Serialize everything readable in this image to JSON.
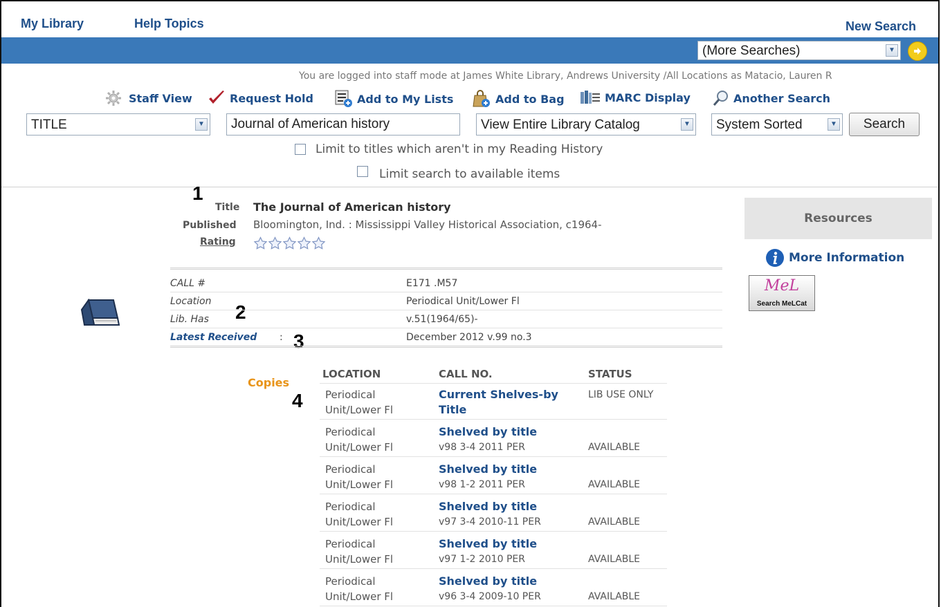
{
  "nav": {
    "my_library": "My Library",
    "help_topics": "Help Topics",
    "new_search": "New Search"
  },
  "bluebar": {
    "more_searches": "(More Searches)"
  },
  "status_line": "You are logged into staff mode at James White Library, Andrews University /All Locations as Matacio, Lauren R",
  "actions": {
    "staff_view": "Staff View",
    "request_hold": "Request Hold",
    "add_to_lists": "Add to My Lists",
    "add_to_bag": "Add to Bag",
    "marc_display": "MARC Display",
    "another_search": "Another Search"
  },
  "search": {
    "field_type": "TITLE",
    "query": "Journal of American history",
    "scope": "View Entire Library Catalog",
    "sort": "System Sorted",
    "button": "Search",
    "limit_history": "Limit to titles which aren't in my Reading History",
    "limit_available": "Limit search to available items"
  },
  "callouts": [
    "1",
    "2",
    "3",
    "4"
  ],
  "record": {
    "title_label": "Title",
    "title_value": "The Journal of American history",
    "published_label": "Published",
    "published_value": "Bloomington, Ind. : Mississippi Valley Historical Association, c1964-",
    "rating_label": "Rating",
    "rating_stars": 5,
    "rating_value": 0
  },
  "holdings": [
    {
      "label": "CALL #",
      "value": "E171 .M57"
    },
    {
      "label": "Location",
      "value": "Periodical Unit/Lower Fl"
    },
    {
      "label": "Lib. Has",
      "value": "v.51(1964/65)-"
    }
  ],
  "latest_received": {
    "label": "Latest Received",
    "sep": ":",
    "value": "December 2012 v.99 no.3"
  },
  "copies": {
    "label": "Copies",
    "headers": [
      "LOCATION",
      "CALL NO.",
      "STATUS"
    ],
    "rows": [
      {
        "location": "Periodical Unit/Lower Fl",
        "call_title": "Current Shelves-by Title",
        "call_sub": "",
        "status": "LIB USE ONLY"
      },
      {
        "location": "Periodical Unit/Lower Fl",
        "call_title": "Shelved by title",
        "call_sub": "v98 3-4 2011 PER",
        "status": "AVAILABLE"
      },
      {
        "location": "Periodical Unit/Lower Fl",
        "call_title": "Shelved by title",
        "call_sub": "v98 1-2 2011 PER",
        "status": "AVAILABLE"
      },
      {
        "location": "Periodical Unit/Lower Fl",
        "call_title": "Shelved by title",
        "call_sub": "v97 3-4 2010-11 PER",
        "status": "AVAILABLE"
      },
      {
        "location": "Periodical Unit/Lower Fl",
        "call_title": "Shelved by title",
        "call_sub": "v97 1-2 2010 PER",
        "status": "AVAILABLE"
      },
      {
        "location": "Periodical Unit/Lower Fl",
        "call_title": "Shelved by title",
        "call_sub": "v96 3-4 2009-10 PER",
        "status": "AVAILABLE"
      }
    ]
  },
  "resources": {
    "heading": "Resources",
    "more_info": "More Information",
    "melcat_logo": "MeL",
    "melcat_label": "Search MeLCat"
  },
  "colors": {
    "link_blue": "#1f4f8a",
    "bar_blue": "#3a79b9",
    "copies_orange": "#e8941a"
  }
}
